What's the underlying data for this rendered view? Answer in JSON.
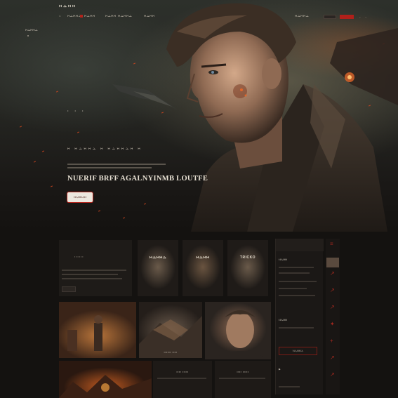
{
  "nav": {
    "logo": "ⲘⲆⲘⲘ",
    "items": [
      "ⲘⲆⲘⲘⲆ",
      "ⲘⲆⲘⲘ",
      "ⲘⲆⲘⲘ",
      "ⲘⲆⲘⲘⲆ",
      "ⲘⲆⲘⲘ"
    ],
    "icons": "◦ ◦"
  },
  "side_label": "ⲘⲆⲘⲘⲆ",
  "hero": {
    "slider_dots": "• • •",
    "subtitle": "Ⲙ ⲘⲆⲘⲘⲆ Ⲙ ⲘⲆⲘⲘⲆⲘ Ⲙ",
    "headline": "NUERIF BRFF AGALNYINMB LOUTFE",
    "cta_label": "ⲘⲆⲘⲘⲆⲘ"
  },
  "portraits": [
    {
      "tag": "ⲘⲆⲘⲘⲆ"
    },
    {
      "tag": "ⲘⲆⲘⲘ"
    },
    {
      "tag": "TRICKO"
    }
  ],
  "sidebar": {
    "label_1": "ⲘⲆⲘⲘ",
    "label_2": "ⲘⲆⲘⲘ",
    "button_label": "ⲘⲆⲘⲘⲆ"
  },
  "colors": {
    "accent_red": "#b0201a",
    "background": "#141210",
    "headline": "#e7e0d3"
  }
}
